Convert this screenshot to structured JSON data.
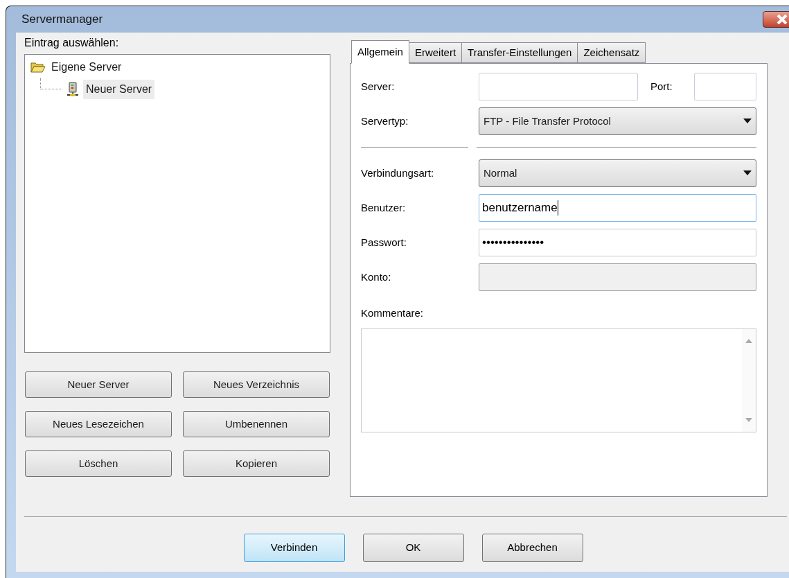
{
  "window": {
    "title": "Servermanager"
  },
  "tree_label": "Eintrag auswählen:",
  "tree": [
    {
      "label": "Eigene Server",
      "kind": "folder",
      "selected": false,
      "children": [
        {
          "label": "Neuer Server",
          "kind": "server",
          "selected": true
        }
      ]
    }
  ],
  "left_buttons": [
    "Neuer Server",
    "Neues Verzeichnis",
    "Neues Lesezeichen",
    "Umbenennen",
    "Löschen",
    "Kopieren"
  ],
  "tabs": [
    {
      "label": "Allgemein",
      "selected": true
    },
    {
      "label": "Erweitert",
      "selected": false
    },
    {
      "label": "Transfer-Einstellungen",
      "selected": false
    },
    {
      "label": "Zeichensatz",
      "selected": false
    }
  ],
  "server": {
    "label": "Server:",
    "port_label": "Port:"
  },
  "servertyp": {
    "label": "Servertyp:",
    "value": "FTP - File Transfer Protocol"
  },
  "verbindungsart": {
    "label": "Verbindungsart:",
    "value": "Normal"
  },
  "fields": [
    {
      "label": "Benutzer:",
      "value": "benutzername",
      "focused": true,
      "disabled": false
    },
    {
      "label": "Passwort:",
      "value": "•••••••••••••••",
      "focused": false,
      "disabled": false
    },
    {
      "label": "Konto:",
      "focused": false,
      "disabled": true
    }
  ],
  "kommentare": {
    "label": "Kommentare:"
  },
  "bottom_buttons": [
    {
      "label": "Verbinden",
      "default": true
    },
    {
      "label": "OK",
      "default": false
    },
    {
      "label": "Abbrechen",
      "default": false
    }
  ]
}
